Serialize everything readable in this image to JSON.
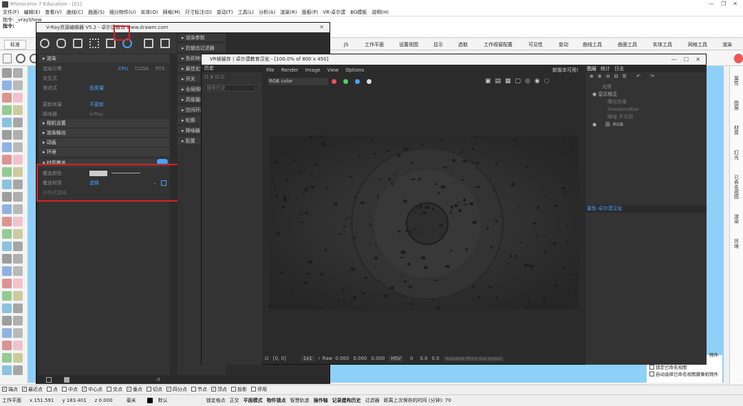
{
  "rhino": {
    "title": "Rhinoceros 7 Education - [01]",
    "menu": [
      "文件(F)",
      "编辑(E)",
      "查看(V)",
      "曲线(C)",
      "曲面(S)",
      "细分物件(U)",
      "实体(O)",
      "网格(M)",
      "尺寸标注(D)",
      "变动(T)",
      "工具(L)",
      "分析(A)",
      "渲染(R)",
      "面板(P)",
      "VR-卓尔谟",
      "BG模板",
      "说明(H)"
    ],
    "cmd_lines": [
      "指令: _vrayShow",
      "指令:"
    ],
    "toolbar_tabs": [
      "标准",
      "JS",
      "工作平面",
      "设置视图",
      "显示",
      "选取",
      "工作视窗配置",
      "可见性",
      "变动",
      "曲线工具",
      "曲面工具",
      "实体工具",
      "网格工具",
      "渲染"
    ],
    "right_tabs": [
      "属性",
      "图层",
      "材质",
      "灯光",
      "已命名视图",
      "渲染",
      "环境"
    ],
    "osnap": [
      "端点",
      "最近点",
      "点",
      "中点",
      "中心点",
      "交点",
      "垂点",
      "切点",
      "四分点",
      "节点",
      "顶点",
      "投影",
      "停用"
    ],
    "osnap_checked": [
      true,
      true,
      false,
      false,
      true,
      false,
      true,
      false,
      true,
      false,
      true,
      false,
      false
    ],
    "status": {
      "plane": "工作平面",
      "x": "x 151.591",
      "y": "y 183.401",
      "z": "z 0.000",
      "unit": "毫米",
      "layer": "默认",
      "items": [
        "锁定格点",
        "正交",
        "平面模式",
        "物件锁点",
        "智慧轨迹",
        "操作轴",
        "记录建构历史",
        "过滤器",
        "距离上次保存的时间 (分钟): 70"
      ]
    },
    "viewport_hint": [
      "物件",
      "锁定已命名视图",
      "自动选择已命名视图摄像机物件"
    ]
  },
  "asset_editor": {
    "title": "V-Ray资源编辑器 V5.2 - 卓尔谟教育 www.drawm.com",
    "sections": {
      "render": "渲染",
      "render_mode": "渲染引擎",
      "cpu": "CPU",
      "cuda": "CUDA",
      "rtx": "RTX",
      "interactive": "交互式",
      "progressive": "渐进式",
      "progressive_val": "低质量",
      "update": "更新效果",
      "update_val": "不更新",
      "denoiser": "降噪器",
      "denoiser_val": "V-Ray",
      "camera": "相机设置",
      "output": "渲染输出",
      "animation": "动画",
      "environment": "环境",
      "material_override": "材质覆盖",
      "override_color": "覆盖颜色",
      "override_material": "覆盖材质",
      "override_material_val": "选择",
      "swarm": "分布式渲染"
    },
    "right_sections": [
      "渲染参数",
      "抗锯齿过滤器",
      "色彩映射",
      "最佳化设置",
      "开关",
      "全局照明",
      "高级摄像机",
      "空间环境",
      "轮廓",
      "降噪器",
      "配置"
    ]
  },
  "vfb": {
    "title": "VR帧缓存丨卓尔谟教育汉化 - [100.0% of 800 x 450]",
    "history_tab": "历史",
    "history_search": "搜索历史",
    "menu": [
      "File",
      "Render",
      "Image",
      "View",
      "Options"
    ],
    "new_version": "新版本可用!",
    "channel": "RGB color",
    "layer_tabs": [
      "图层",
      "统计",
      "日志"
    ],
    "layers": [
      "光效",
      "显示校正",
      "曝光效果",
      "Sharpen/Blur",
      "降噪 不可用",
      "源: RGB"
    ],
    "props_label": "属性-卓尔谟汉化",
    "bottom": {
      "coords": "[0, 0]",
      "zoom": "1x1",
      "raw": "Raw",
      "r": "0.000",
      "g": "0.000",
      "b": "0.000",
      "mode": "HSV",
      "h": "0",
      "s": "0.0",
      "v": "0.0",
      "preset": "Autodesk Rhino bus output"
    }
  },
  "colors": {
    "accent_red": "#e02020",
    "vray_blue": "#4aa3ff",
    "viewport_blue": "#8fd0f8"
  }
}
